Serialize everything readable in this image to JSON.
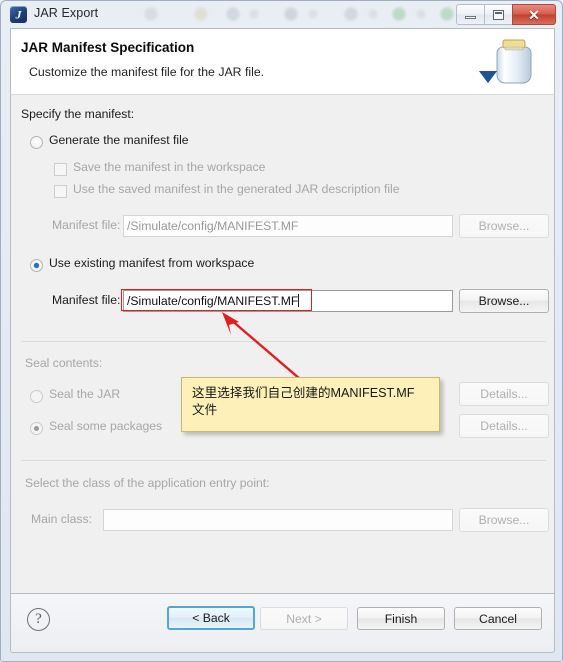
{
  "window": {
    "title": "JAR Export",
    "app_icon_glyph": "J",
    "controls": {
      "minimize": "minimize-icon",
      "maximize": "maximize-icon",
      "close": "✕"
    }
  },
  "header": {
    "title": "JAR Manifest Specification",
    "subtitle": "Customize the manifest file for the JAR file.",
    "art": "jar-illustration"
  },
  "manifest_group": {
    "legend": "Specify the manifest:",
    "generate_option": {
      "label": "Generate the manifest file",
      "selected": false
    },
    "save_in_workspace": {
      "label": "Save the manifest in the workspace",
      "checked": false
    },
    "use_saved_manifest": {
      "label": "Use the saved manifest in the generated JAR description file",
      "checked": false
    },
    "generate_file_label": "Manifest file:",
    "generate_file_value": "/Simulate/config/MANIFEST.MF",
    "generate_browse_label": "Browse...",
    "use_existing_option": {
      "label": "Use existing manifest from workspace",
      "selected": true
    },
    "existing_file_label": "Manifest file:",
    "existing_file_value": "/Simulate/config/MANIFEST.MF",
    "existing_browse_label": "Browse..."
  },
  "seal_group": {
    "legend": "Seal contents:",
    "seal_jar": {
      "label": "Seal the JAR",
      "selected": false
    },
    "seal_packages": {
      "label": "Seal some packages",
      "selected": true
    },
    "details_jar_label": "Details...",
    "details_packages_label": "Details..."
  },
  "entry_group": {
    "legend": "Select the class of the application entry point:",
    "main_class_label": "Main class:",
    "main_class_value": "",
    "main_class_browse_label": "Browse..."
  },
  "buttonbar": {
    "help": "?",
    "back": "< Back",
    "next": "Next >",
    "finish": "Finish",
    "cancel": "Cancel"
  },
  "annotation": {
    "line1": "这里选择我们自己创建的MANIFEST.MF",
    "line2": "文件",
    "highlight_color": "#e02020",
    "callout_bg": "#fdf0b8"
  }
}
